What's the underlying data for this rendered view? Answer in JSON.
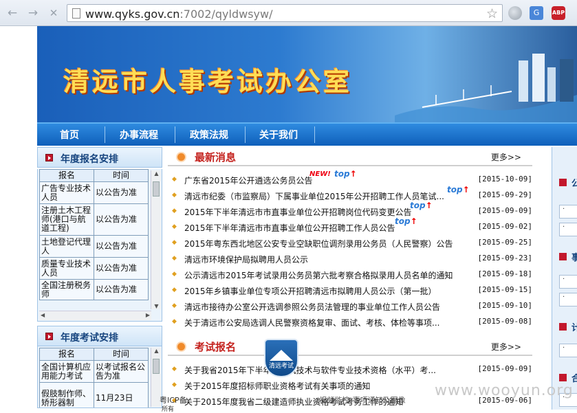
{
  "browser": {
    "url_host": "www.qyks.gov.cn",
    "url_rest": ":7002/qyldwsyw/"
  },
  "site": {
    "title": "清远市人事考试办公室",
    "nav": [
      "首页",
      "办事流程",
      "政策法规",
      "关于我们"
    ]
  },
  "left": {
    "annual_registration": {
      "title": "年度报名安排",
      "headers": [
        "报名",
        "时间"
      ],
      "rows": [
        {
          "name": "广告专业技术人员",
          "time": "以公告为准"
        },
        {
          "name": "注册土木工程师(港口与航道工程)",
          "time": "以公告为准"
        },
        {
          "name": "土地登记代理人",
          "time": "以公告为准"
        },
        {
          "name": "质量专业技术人员",
          "time": "以公告为准"
        },
        {
          "name": "全国注册税务师",
          "time": "以公告为准"
        }
      ]
    },
    "annual_exam": {
      "title": "年度考试安排",
      "headers": [
        "报名",
        "时间"
      ],
      "rows": [
        {
          "name": "全国计算机应用能力考试",
          "time": "以考试报名公告为准"
        },
        {
          "name": "假肢制作师、矫形器制",
          "time": "11月23日"
        }
      ]
    }
  },
  "news": {
    "title": "最新消息",
    "more": "更多>>",
    "items": [
      {
        "title": "广东省2015年公开遴选公务员公告",
        "date": "[2015-10-09]",
        "new": "NEW!",
        "top": "top"
      },
      {
        "title": "清远市纪委（市监察局）下属事业单位2015年公开招聘工作人员笔试...",
        "date": "[2015-09-29]",
        "top": "top"
      },
      {
        "title": "2015年下半年清远市市直事业单位公开招聘岗位代码变更公告",
        "date": "[2015-09-09]",
        "top": "top"
      },
      {
        "title": "2015年下半年清远市市直事业单位公开招聘工作人员公告",
        "date": "[2015-09-02]",
        "top": "top"
      },
      {
        "title": "2015年粤东西北地区公安专业空缺职位调剂录用公务员（人民警察）公告",
        "date": "[2015-09-25]"
      },
      {
        "title": "清远市环境保护局拟聘用人员公示",
        "date": "[2015-09-23]"
      },
      {
        "title": "公示清远市2015年考试录用公务员第六批考察合格拟录用人员名单的通知",
        "date": "[2015-09-18]"
      },
      {
        "title": "2015年乡镇事业单位专项公开招聘清远市拟聘用人员公示（第一批）",
        "date": "[2015-09-15]"
      },
      {
        "title": "清远市接待办公室公开选调参照公务员法管理的事业单位工作人员公告",
        "date": "[2015-09-10]"
      },
      {
        "title": "关于清远市公安局选调人民警察资格复审、面试、考核、体检等事项...",
        "date": "[2015-09-08]"
      }
    ]
  },
  "exam": {
    "title": "考试报名",
    "more": "更多>>",
    "items": [
      {
        "title": "关于我省2015年下半年计算机技术与软件专业技术资格（水平）考...",
        "date": "[2015-09-09]"
      },
      {
        "title": "关于2015年度招标师职业资格考试有关事项的通知",
        "date": ""
      },
      {
        "title": "关于2015年度我省二级建造师执业资格考试考务工作的通知",
        "date": "[2015-09-06]"
      }
    ]
  },
  "right": {
    "labels": [
      "公",
      "事",
      "计",
      "合"
    ]
  },
  "overlays": {
    "badge_text": "清远考试",
    "icp": "粤ICP备",
    "icp2": "所有",
    "video_note": "(视频监控)事项通知及图像",
    "watermark": "www.wooyun.org"
  },
  "colors": {
    "nav_bg": "#1a6fcc",
    "accent_red": "#c4221e",
    "banner_title": "#ffdd55"
  }
}
